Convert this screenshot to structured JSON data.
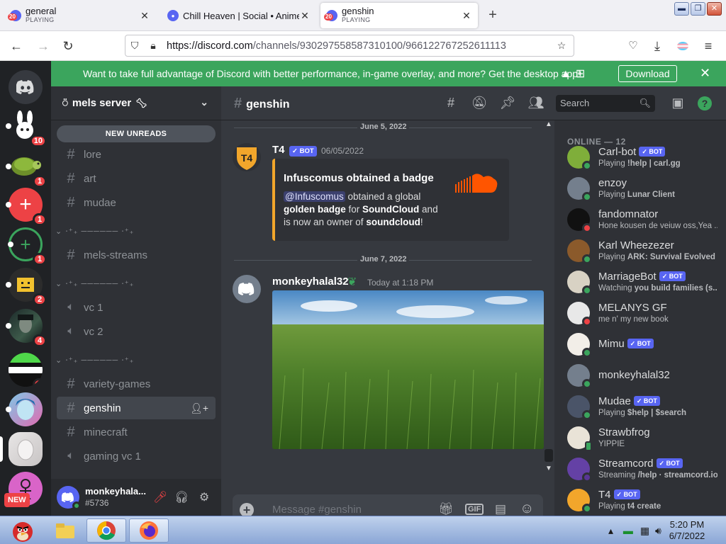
{
  "browser": {
    "tabs": [
      {
        "title": "general",
        "subtitle": "PLAYING",
        "icon": "discord-icon",
        "badge": "20"
      },
      {
        "title": "Chill Heaven | Social • Anime",
        "subtitle": "",
        "icon": "discord-icon"
      },
      {
        "title": "genshin",
        "subtitle": "PLAYING",
        "icon": "discord-icon",
        "badge": "20",
        "active": true
      }
    ],
    "url_host": "https://discord.com",
    "url_path": "/channels/930297558587310100/966122767252611113"
  },
  "banner": {
    "text": "Want to take full advantage of Discord with better performance, in-game overlay, and more? Get the desktop app!",
    "download_label": "Download"
  },
  "guilds": [
    {
      "badge": "10"
    },
    {
      "badge": "1"
    },
    {
      "badge": "1"
    },
    {
      "badge": "1"
    },
    {
      "badge": "2"
    },
    {
      "badge": "4"
    },
    {
      "badge": "1"
    },
    {
      "badge": ""
    },
    {
      "badge": ""
    },
    {
      "badge": "NEW"
    }
  ],
  "server": {
    "name": "mels server",
    "new_unreads": "NEW UNREADS",
    "channels": [
      {
        "name": "lore",
        "type": "text"
      },
      {
        "name": "art",
        "type": "text"
      },
      {
        "name": "mudae",
        "type": "text"
      },
      {
        "name": "mels-streams",
        "type": "text"
      },
      {
        "name": "vc 1",
        "type": "voice"
      },
      {
        "name": "vc 2",
        "type": "voice"
      },
      {
        "name": "variety-games",
        "type": "text"
      },
      {
        "name": "genshin",
        "type": "text",
        "active": true
      },
      {
        "name": "minecraft",
        "type": "text"
      },
      {
        "name": "gaming vc 1",
        "type": "voice"
      }
    ]
  },
  "user": {
    "name": "monkeyhala...",
    "tag": "#5736"
  },
  "chat": {
    "channel_name": "genshin",
    "search_placeholder": "Search",
    "dates": [
      "June 5, 2022",
      "June 7, 2022"
    ],
    "messages": [
      {
        "author": "T4",
        "bot": "BOT",
        "timestamp": "06/05/2022",
        "embed": {
          "title": "Infuscomus obtained a badge",
          "mention": "@Infuscomus",
          "text1": "obtained a global",
          "bold1": "golden badge",
          "text2": "for",
          "bold2": "SoundCloud",
          "text3": "and is now an owner of",
          "bold3": "soundcloud",
          "text4": "!"
        }
      },
      {
        "author": "monkeyhalal32",
        "timestamp": "Today at 1:18 PM",
        "image": "green grass field under blue sky"
      }
    ],
    "input_placeholder": "Message #genshin",
    "gif_label": "GIF"
  },
  "members": {
    "header": "ONLINE — 12",
    "list": [
      {
        "name": "Carl-bot",
        "bot": "BOT",
        "status_prefix": "Playing ",
        "status_bold": "!help | carl.gg",
        "state": "online",
        "color": "#7fae3a"
      },
      {
        "name": "enzoy",
        "status_prefix": "Playing ",
        "status_bold": "Lunar Client",
        "state": "online",
        "color": "#747f8d"
      },
      {
        "name": "fandomnator",
        "status_prefix": "Hone kousen de veiuw oss,Yea ...",
        "status_bold": "",
        "state": "dnd",
        "color": "#111111"
      },
      {
        "name": "Karl Wheezezer",
        "status_prefix": "Playing ",
        "status_bold": "ARK: Survival Evolved",
        "state": "online",
        "color": "#8b5a2b"
      },
      {
        "name": "MarriageBot",
        "bot": "BOT",
        "status_prefix": "Watching ",
        "status_bold": "you build families (s...",
        "state": "online",
        "color": "#d8d2c4"
      },
      {
        "name": "MELANYS GF",
        "status_prefix": "me n' my new book",
        "status_bold": "",
        "state": "dnd",
        "color": "#e8e8e8"
      },
      {
        "name": "Mimu",
        "bot": "BOT",
        "status_prefix": "",
        "status_bold": "",
        "state": "online",
        "color": "#f2eee8"
      },
      {
        "name": "monkeyhalal32",
        "status_prefix": "",
        "status_bold": "",
        "state": "online",
        "color": "#747f8d"
      },
      {
        "name": "Mudae",
        "bot": "BOT",
        "status_prefix": "Playing ",
        "status_bold": "$help | $search",
        "state": "online",
        "color": "#4a5468"
      },
      {
        "name": "Strawbfrog",
        "status_prefix": "YIPPIE",
        "status_bold": "",
        "state": "mobile",
        "color": "#e9e3d7"
      },
      {
        "name": "Streamcord",
        "bot": "BOT",
        "status_prefix": "Streaming ",
        "status_bold": "/help · streamcord.io",
        "state": "streaming",
        "color": "#6441a5"
      },
      {
        "name": "T4",
        "bot": "BOT",
        "status_prefix": "Playing ",
        "status_bold": "t4 create",
        "state": "online",
        "color": "#f2a62b"
      }
    ]
  },
  "taskbar": {
    "time": "5:20 PM",
    "date": "6/7/2022"
  },
  "colors": {
    "discord_blurple": "#5865f2",
    "banner_green": "#3ba55d",
    "bg_chat": "#36393f",
    "bg_sidebar": "#2f3136",
    "bg_guilds": "#202225"
  }
}
